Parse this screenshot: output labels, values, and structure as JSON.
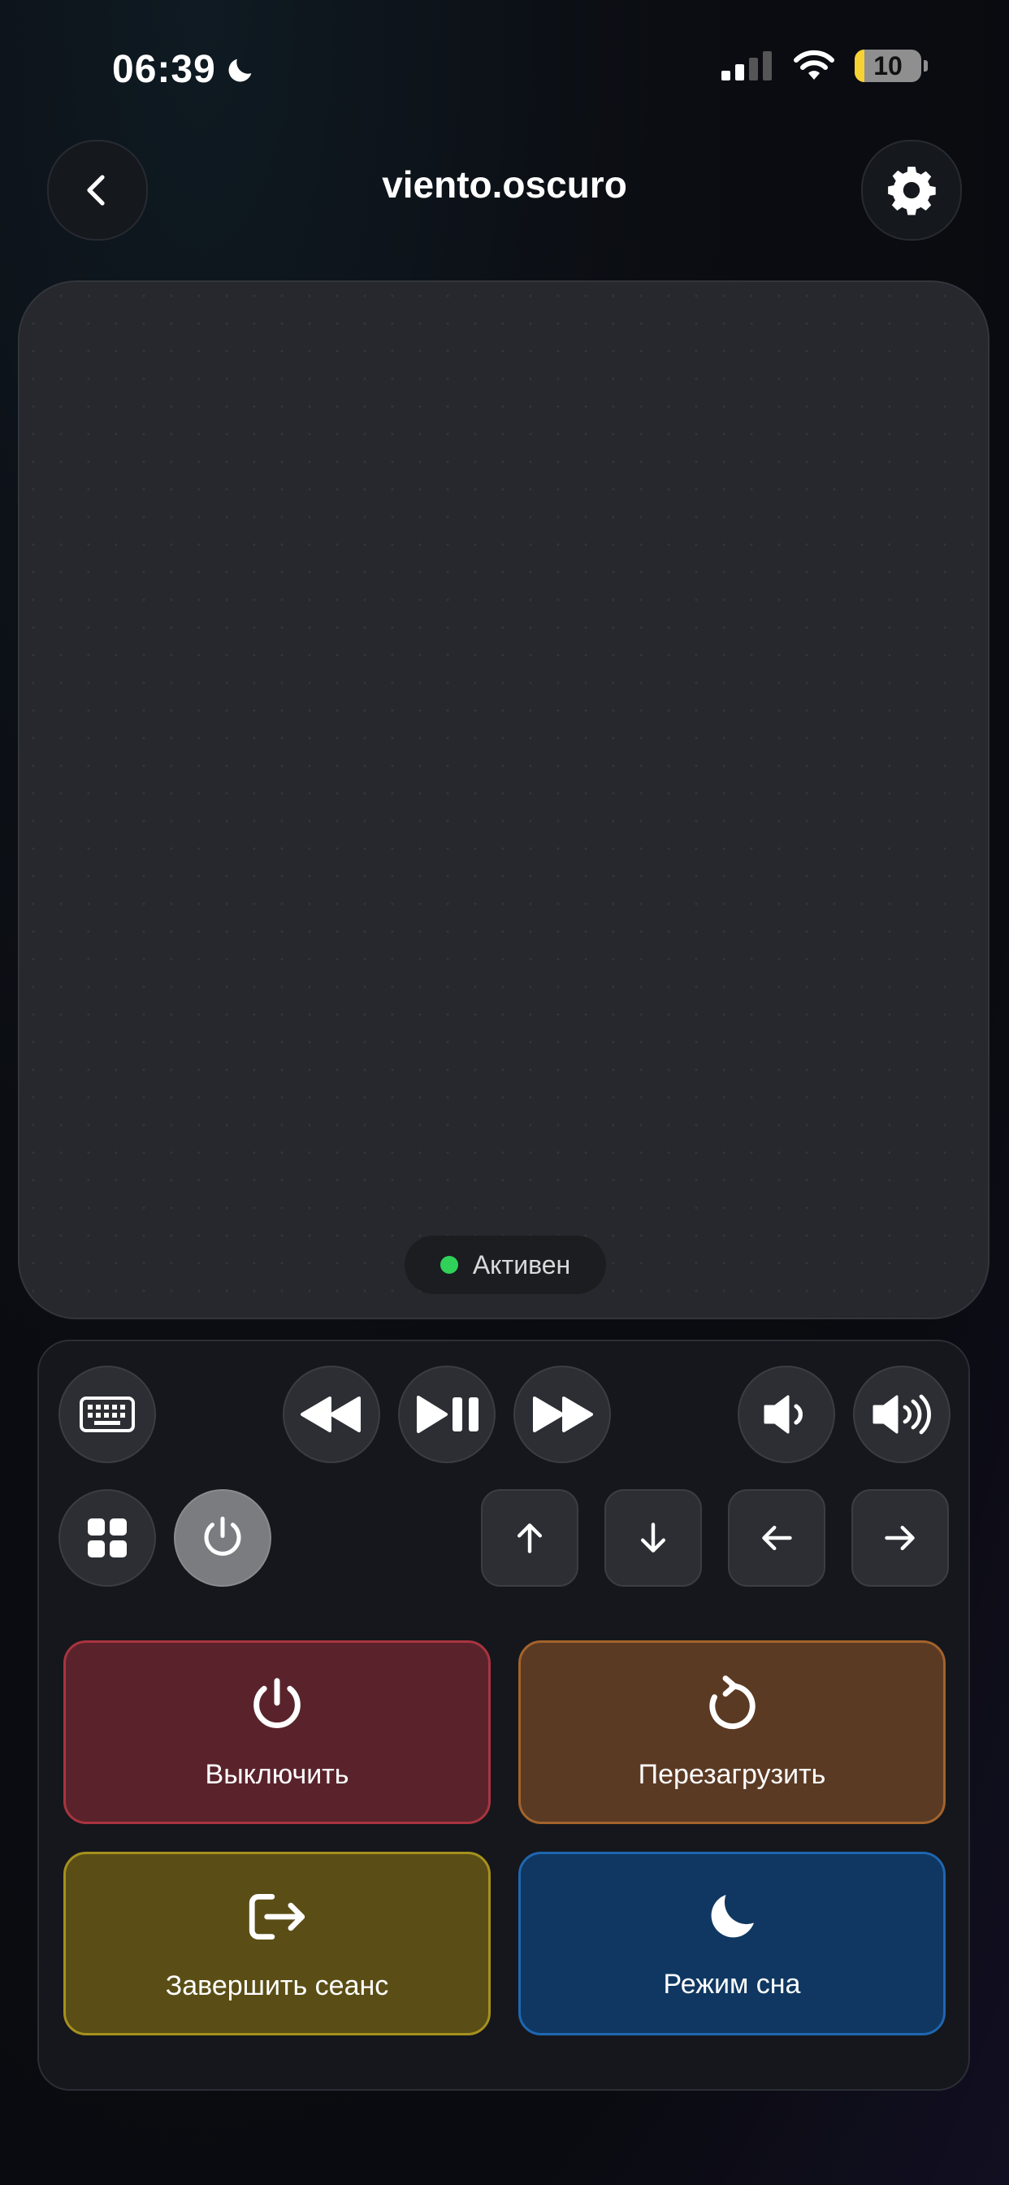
{
  "status_bar": {
    "time": "06:39",
    "battery": "10"
  },
  "header": {
    "title": "viento.oscuro"
  },
  "trackpad": {
    "status": "Активен"
  },
  "actions": {
    "shutdown": "Выключить",
    "restart": "Перезагрузить",
    "logout": "Завершить сеанс",
    "sleep": "Режим сна"
  },
  "colors": {
    "active_dot": "#30d158",
    "shutdown_bg": "#5a232b",
    "restart_bg": "#5b3a24",
    "logout_bg": "#5a4e16",
    "sleep_bg": "#0f3761",
    "battery_accent": "#f7d234"
  }
}
